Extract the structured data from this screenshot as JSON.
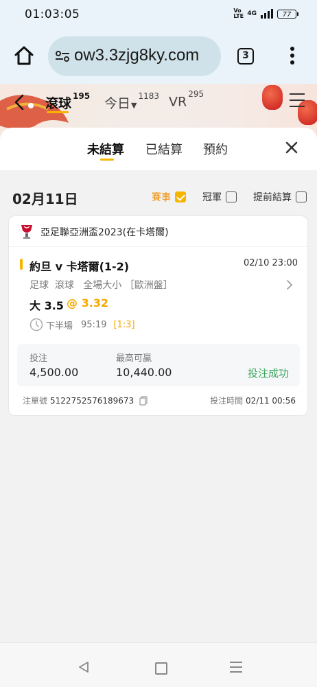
{
  "status_bar": {
    "time": "01:03:05",
    "volte": "Vo LTE",
    "network": "4G",
    "battery": "77"
  },
  "browser": {
    "url": "ow3.3zjg8ky.com",
    "tab_count": "3"
  },
  "header": {
    "items": [
      {
        "label": "滾球",
        "count": "195",
        "active": true
      },
      {
        "label": "今日",
        "count": "1183",
        "active": false
      },
      {
        "label": "VR",
        "count": "295",
        "active": false
      }
    ]
  },
  "sheet": {
    "tabs": [
      {
        "label": "未結算",
        "active": true
      },
      {
        "label": "已結算",
        "active": false
      },
      {
        "label": "預約",
        "active": false
      }
    ]
  },
  "date_row": {
    "date": "02月11日",
    "filters": [
      {
        "label": "賽事",
        "checked": true
      },
      {
        "label": "冠軍",
        "checked": false
      },
      {
        "label": "提前結算",
        "checked": false
      }
    ]
  },
  "bet_card": {
    "league": "亞足聯亞洲盃2023(在卡塔爾)",
    "match": "約旦 v 卡塔爾(1-2)",
    "match_time": "02/10 23:00",
    "bet_type": "足球  滾球   全場大小 ［歐洲盤］",
    "selection": "大 3.5",
    "odds": "@ 3.32",
    "period": "下半場",
    "clock": "95:19",
    "score": "[1:3]",
    "stake_label": "投注",
    "stake_value": "4,500.00",
    "max_win_label": "最高可贏",
    "max_win_value": "10,440.00",
    "status": "投注成功",
    "ticket_label": "注單號",
    "ticket_no": "5122752576189673",
    "bet_time_label": "投注時間",
    "bet_time": "02/11 00:56"
  },
  "colors": {
    "accent": "#f6b500",
    "success": "#3aa55b",
    "odds": "#f6a800"
  }
}
